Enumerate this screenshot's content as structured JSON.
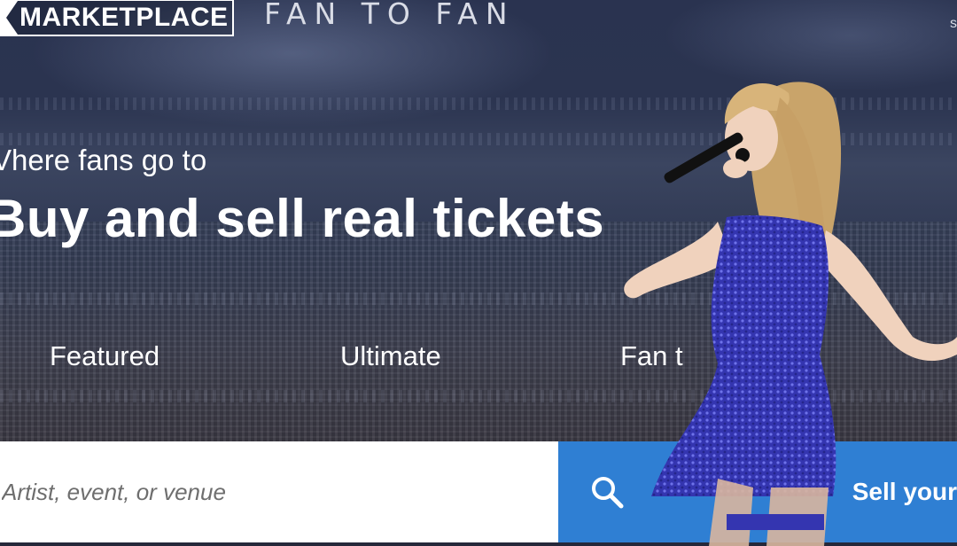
{
  "header": {
    "logo_text": "MARKETPLACE",
    "tagline": "FAN TO FAN",
    "top_right_fragment": "s"
  },
  "hero": {
    "subtitle": "Vhere fans go to",
    "headline": "Buy and sell real tickets"
  },
  "tabs": [
    {
      "label": "Featured"
    },
    {
      "label": "Ultimate"
    },
    {
      "label": "Fan t"
    }
  ],
  "search": {
    "placeholder": "Artist, event, or venue",
    "button_icon": "search-icon"
  },
  "sell_button": {
    "label": "Sell your"
  },
  "colors": {
    "accent_blue": "#2f7fd3",
    "dress_blue": "#3a3bb8",
    "background_navy": "#2b3450"
  }
}
